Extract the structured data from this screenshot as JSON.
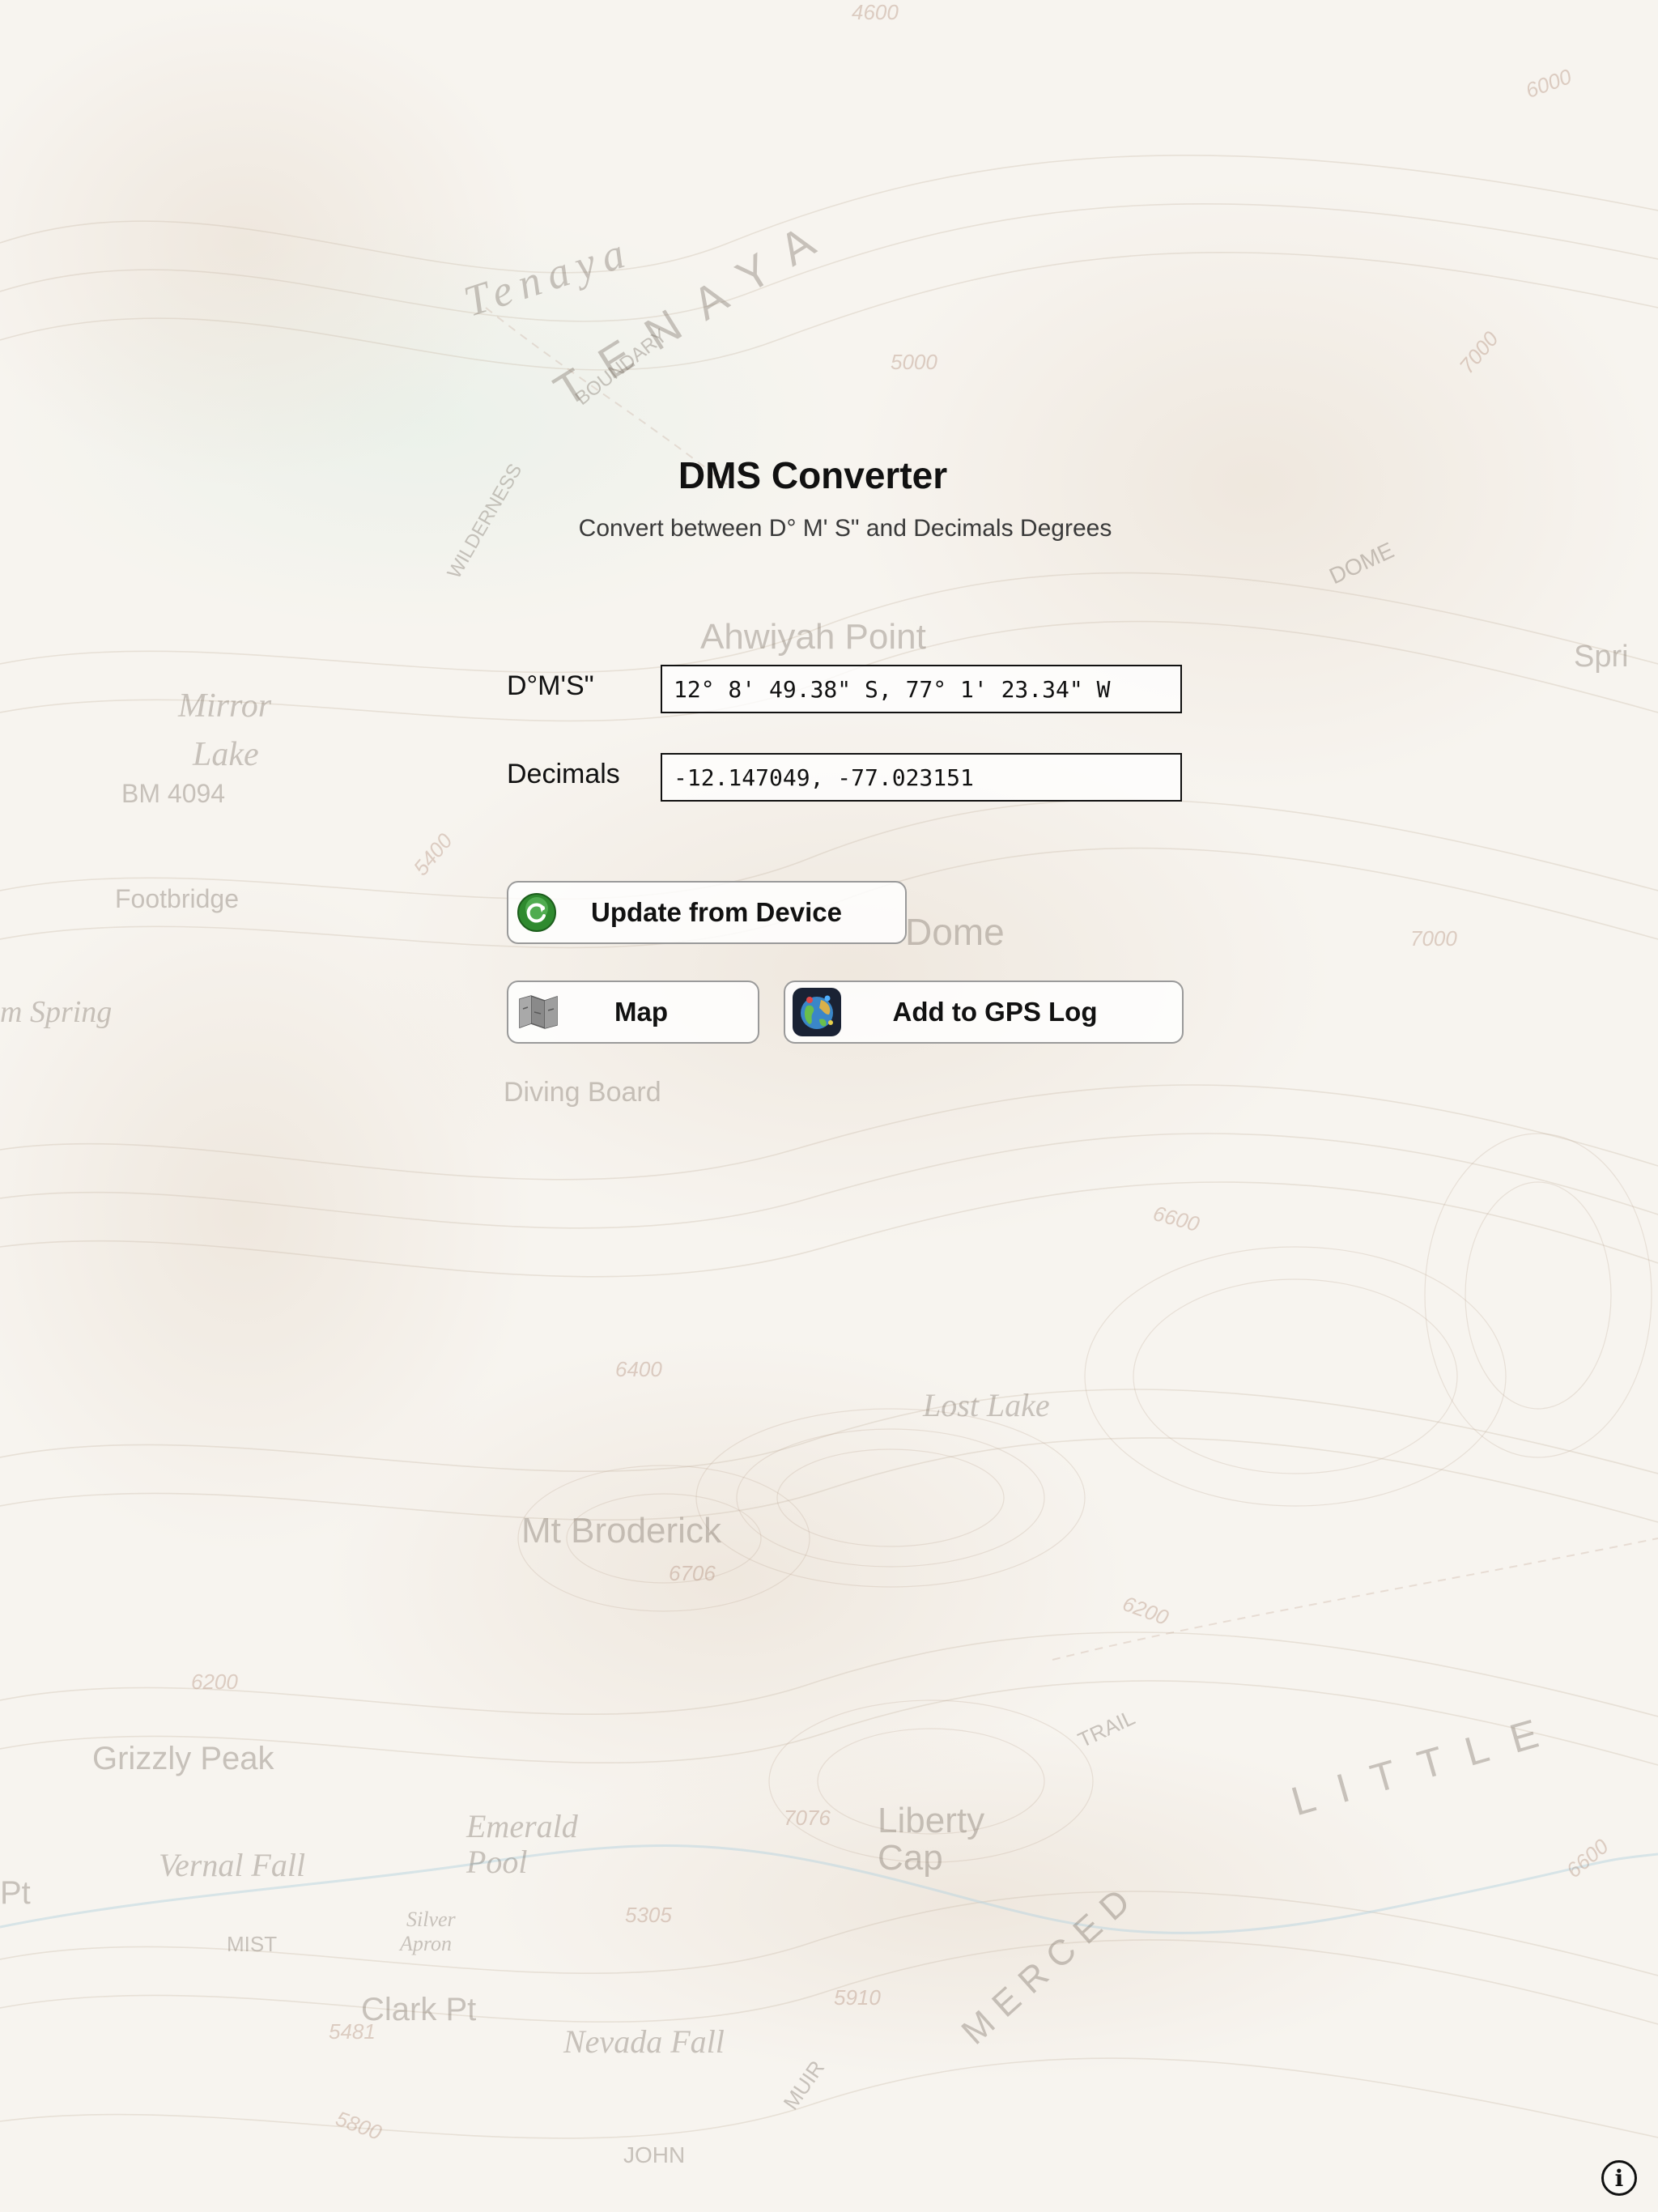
{
  "app": {
    "title": "DMS Converter",
    "subtitle": "Convert between D° M' S\" and Decimals Degrees"
  },
  "fields": {
    "dms": {
      "label": "D°M'S\"",
      "value": "12° 8' 49.38\" S, 77° 1' 23.34\" W"
    },
    "decimals": {
      "label": "Decimals",
      "value": "-12.147049, -77.023151"
    }
  },
  "buttons": {
    "update": {
      "label": "Update from Device",
      "icon": "refresh-icon"
    },
    "map": {
      "label": "Map",
      "icon": "folded-map-icon"
    },
    "gps_log": {
      "label": "Add to GPS Log",
      "icon": "globe-icon"
    },
    "info": {
      "label": "i",
      "icon": "info-icon"
    }
  },
  "map_labels": {
    "tenaya": "Tenaya",
    "tenaya_big": "TENAYA",
    "boundary": "BOUNDARY",
    "wilderness": "WILDERNESS",
    "ahwiyah": "Ahwiyah Point",
    "mirror": "Mirror",
    "lake": "Lake",
    "bm": "BM 4094",
    "footbridge": "Footbridge",
    "spring": "m Spring",
    "dome": "Dome",
    "dome_upper": "DOME",
    "diving": "Diving Board",
    "lost_lake": "Lost Lake",
    "broderick": "Mt Broderick",
    "grizzly": "Grizzly Peak",
    "vernal": "Vernal Fall",
    "emerald": "Emerald",
    "pool": "Pool",
    "liberty": "Liberty",
    "cap": "Cap",
    "little": "LITTLE",
    "merced": "MERCED",
    "clark": "Clark Pt",
    "nevada": "Nevada Fall",
    "silver": "Silver",
    "apron": "Apron",
    "mist": "MIST",
    "trail": "TRAIL",
    "john": "JOHN",
    "muir": "MUIR",
    "spring_right": "Spri",
    "pt_left": "Pt",
    "n4600": "4600",
    "n6000": "6000",
    "n5000": "5000",
    "n7000": "7000",
    "n6600": "6600",
    "n6400": "6400",
    "n6706": "6706",
    "n6200": "6200",
    "n5400": "5400",
    "n7076": "7076",
    "n5305": "5305",
    "n5910": "5910",
    "n5481": "5481",
    "n5800": "5800"
  },
  "colors": {
    "background": "#f6f2ec",
    "text": "#111111",
    "button_border": "#9a9a9a"
  }
}
